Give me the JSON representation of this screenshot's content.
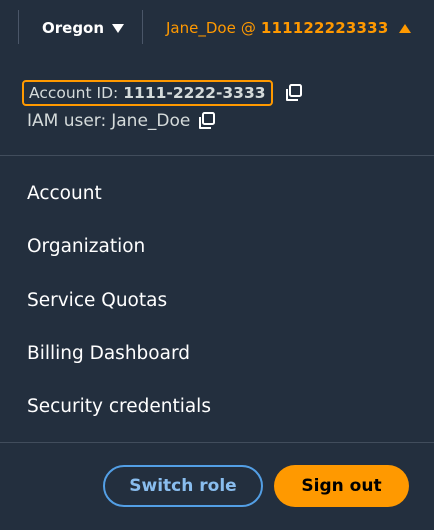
{
  "topbar": {
    "region_label": "Oregon",
    "account_user": "Jane_Doe",
    "account_at": "@",
    "account_number": "111122223333",
    "accent_color": "#ff9900"
  },
  "account_info": {
    "account_id_label": "Account ID:",
    "account_id_value": "1111-2222-3333",
    "iam_user_label": "IAM user:",
    "iam_user_value": "Jane_Doe",
    "copy_icon": "copy-icon"
  },
  "menu": {
    "items": [
      {
        "label": "Account"
      },
      {
        "label": "Organization"
      },
      {
        "label": "Service Quotas"
      },
      {
        "label": "Billing Dashboard"
      },
      {
        "label": "Security credentials"
      }
    ]
  },
  "actions": {
    "switch_role_label": "Switch role",
    "sign_out_label": "Sign out"
  },
  "colors": {
    "background": "#232f3e",
    "accent": "#ff9900",
    "link_blue": "#89bdee"
  }
}
